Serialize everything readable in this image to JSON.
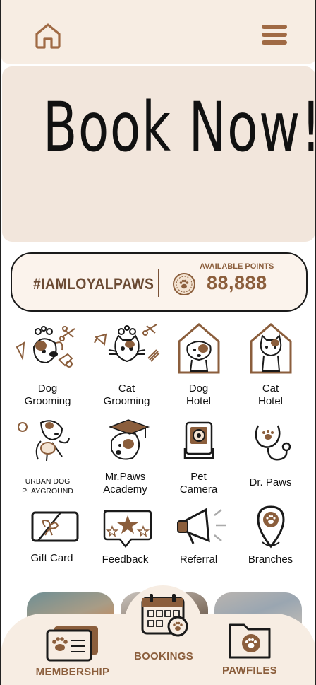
{
  "header": {
    "home_icon": "home-icon",
    "menu_icon": "hamburger-menu-icon"
  },
  "banner": {
    "text": "Book Now!"
  },
  "points": {
    "hashtag": "#IAMLOYALPAWS",
    "label": "AVAILABLE POINTS",
    "value": "88,888",
    "icon": "paw-coin-icon"
  },
  "services": [
    {
      "label": "Dog\nGrooming",
      "icon": "dog-grooming-icon"
    },
    {
      "label": "Cat\nGrooming",
      "icon": "cat-grooming-icon"
    },
    {
      "label": "Dog\nHotel",
      "icon": "dog-hotel-icon"
    },
    {
      "label": "Cat\nHotel",
      "icon": "cat-hotel-icon"
    },
    {
      "label": "URBAN DOG\nPLAYGROUND",
      "icon": "dog-playground-icon"
    },
    {
      "label": "Mr.Paws\nAcademy",
      "icon": "academy-icon"
    },
    {
      "label": "Pet\nCamera",
      "icon": "pet-camera-icon"
    },
    {
      "label": "Dr. Paws",
      "icon": "stethoscope-icon"
    },
    {
      "label": "Gift Card",
      "icon": "gift-card-icon"
    },
    {
      "label": "Feedback",
      "icon": "feedback-star-icon"
    },
    {
      "label": "Referral",
      "icon": "megaphone-icon"
    },
    {
      "label": "Branches",
      "icon": "location-pin-icon"
    }
  ],
  "bottom_nav": {
    "membership": "MEMBERSHIP",
    "bookings": "BOOKINGS",
    "pawfiles": "PAWFILES"
  },
  "colors": {
    "accent": "#8b5e3c",
    "cream": "#f7ede3",
    "banner": "#f2e6dc"
  }
}
